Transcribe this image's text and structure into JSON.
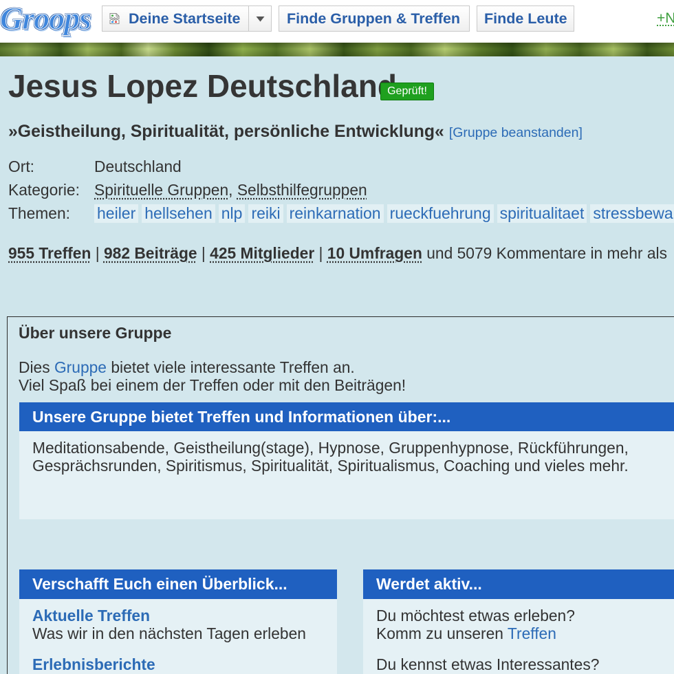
{
  "colors": {
    "page_background": "#cfe5eb",
    "accent_bar": "#1f60c0",
    "link": "#2c6bb6",
    "verified_badge": "#1fa01f",
    "new_action": "#3f9f3f"
  },
  "icons": {
    "home": "broken-image-icon",
    "home_menu": "caret-down-icon"
  },
  "nav": {
    "logo": "Groops",
    "home_label": "Deine Startseite",
    "find_groups_label": "Finde Gruppen & Treffen",
    "find_people_label": "Finde Leute",
    "new_action_label": "+N"
  },
  "group": {
    "title": "Jesus Lopez Deutschland",
    "verified_badge": "Geprüft!",
    "tagline": "»Geistheilung, Spiritualität, persönliche Entwicklung«",
    "report_link": "[Gruppe beanstanden]",
    "location": {
      "label": "Ort:",
      "value": "Deutschland"
    },
    "category": {
      "label": "Kategorie:",
      "items": [
        "Spirituelle Gruppen",
        "Selbsthilfegruppen"
      ],
      "separator": ", "
    },
    "topics": {
      "label": "Themen:",
      "items": [
        "heiler",
        "hellsehen",
        "nlp",
        "reiki",
        "reinkarnation",
        "rueckfuehrung",
        "spiritualitaet",
        "stressbewa"
      ]
    },
    "stats": {
      "items": [
        "955 Treffen",
        "982 Beiträge",
        "425 Mitglieder",
        "10 Umfragen"
      ],
      "separator": " | ",
      "trailing_text": " und 5079 Kommentare in mehr als"
    }
  },
  "about": {
    "heading": "Über unsere Gruppe",
    "intro": {
      "prefix": "Dies ",
      "link": "Gruppe",
      "suffix": " bietet viele interessante Treffen an."
    },
    "intro_line2": "Viel Spaß bei einem der Treffen oder mit den Beiträgen!",
    "offers": {
      "heading": "Unsere Gruppe bietet Treffen und Informationen über:...",
      "text": "Meditationsabende, Geistheilung(stage), Hypnose, Gruppenhypnose, Rückführungen, Gesprächsrunden, Spiritismus, Spiritualität, Spiritualismus, Coaching und vieles mehr."
    }
  },
  "overview": {
    "heading": "Verschafft Euch einen Überblick...",
    "items": [
      {
        "title": "Aktuelle Treffen",
        "description": "Was wir in den nächsten Tagen erleben"
      },
      {
        "title": "Erlebnisberichte"
      }
    ]
  },
  "get_active": {
    "heading": "Werdet aktiv...",
    "items": [
      {
        "question": "Du möchtest etwas erleben?",
        "prefix": "Komm zu unseren ",
        "link": "Treffen"
      },
      {
        "question": "Du kennst etwas Interessantes?"
      }
    ]
  }
}
